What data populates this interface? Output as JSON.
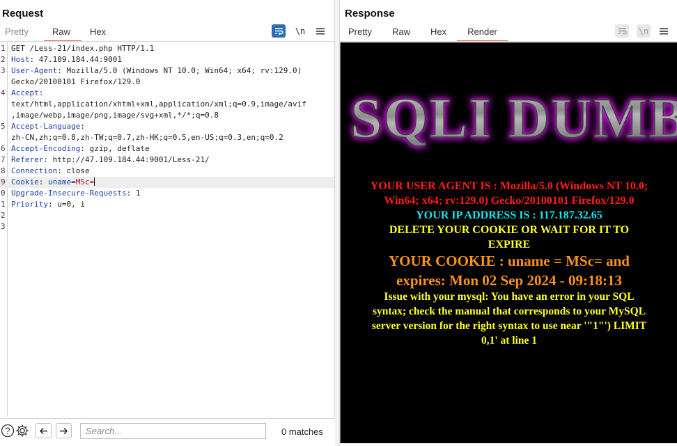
{
  "layout_switcher": {
    "options": [
      "split-columns-icon",
      "split-rows-icon",
      "tabs-icon"
    ],
    "active": 0
  },
  "request": {
    "title": "Request",
    "tabs": [
      {
        "label": "Pretty",
        "active": false,
        "muted": true
      },
      {
        "label": "Raw",
        "active": true,
        "muted": false
      },
      {
        "label": "Hex",
        "active": false,
        "muted": false
      }
    ],
    "toolbar": {
      "wrap_icon": "wrap-lines-icon",
      "newline_label": "\\n",
      "menu_icon": "menu-icon"
    },
    "lines": [
      {
        "n": "1",
        "parts": [
          {
            "t": "GET /Less-21/index.php HTTP/1.1",
            "c": ""
          }
        ]
      },
      {
        "n": "2",
        "parts": [
          {
            "t": "Host",
            "c": "hk"
          },
          {
            "t": ": 47.109.184.44:9001",
            "c": ""
          }
        ]
      },
      {
        "n": "3",
        "parts": [
          {
            "t": "User-Agent",
            "c": "hk"
          },
          {
            "t": ": Mozilla/5.0 (Windows NT 10.0; Win64; x64; rv:129.0)",
            "c": ""
          }
        ]
      },
      {
        "n": "",
        "parts": [
          {
            "t": "Gecko/20100101 Firefox/129.0",
            "c": ""
          }
        ]
      },
      {
        "n": "4",
        "parts": [
          {
            "t": "Accept",
            "c": "hk"
          },
          {
            "t": ":",
            "c": ""
          }
        ]
      },
      {
        "n": "",
        "parts": [
          {
            "t": "text/html,application/xhtml+xml,application/xml;q=0.9,image/avif",
            "c": ""
          }
        ]
      },
      {
        "n": "",
        "parts": [
          {
            "t": ",image/webp,image/png,image/svg+xml,*/*;q=0.8",
            "c": ""
          }
        ]
      },
      {
        "n": "5",
        "parts": [
          {
            "t": "Accept-Language",
            "c": "hk"
          },
          {
            "t": ":",
            "c": ""
          }
        ]
      },
      {
        "n": "",
        "parts": [
          {
            "t": "zh-CN,zh;q=0.8,zh-TW;q=0.7,zh-HK;q=0.5,en-US;q=0.3,en;q=0.2",
            "c": ""
          }
        ]
      },
      {
        "n": "6",
        "parts": [
          {
            "t": "Accept-Encoding",
            "c": "hk"
          },
          {
            "t": ": gzip, deflate",
            "c": ""
          }
        ]
      },
      {
        "n": "7",
        "parts": [
          {
            "t": "Referer",
            "c": "hk"
          },
          {
            "t": ": http://47.109.184.44:9001/Less-21/",
            "c": ""
          }
        ]
      },
      {
        "n": "8",
        "parts": [
          {
            "t": "Connection",
            "c": "hk"
          },
          {
            "t": ": close",
            "c": ""
          }
        ]
      },
      {
        "n": "9",
        "parts": [
          {
            "t": "Cookie",
            "c": "hk"
          },
          {
            "t": ": ",
            "c": ""
          },
          {
            "t": "uname",
            "c": "hk"
          },
          {
            "t": "=",
            "c": ""
          },
          {
            "t": "MSc=",
            "c": "cv"
          }
        ],
        "highlight": true,
        "caret": true
      },
      {
        "n": "0",
        "parts": [
          {
            "t": "Upgrade-Insecure-Requests",
            "c": "hk"
          },
          {
            "t": ": 1",
            "c": ""
          }
        ]
      },
      {
        "n": "1",
        "parts": [
          {
            "t": "Priority",
            "c": "hk"
          },
          {
            "t": ": u=0, i",
            "c": ""
          }
        ]
      },
      {
        "n": "2",
        "parts": []
      },
      {
        "n": "3",
        "parts": []
      }
    ],
    "search": {
      "placeholder": "Search...",
      "value": "",
      "matches": "0 matches",
      "help_icon": "help-icon",
      "settings_icon": "gear-icon",
      "prev_icon": "arrow-left-icon",
      "next_icon": "arrow-right-icon"
    }
  },
  "response": {
    "title": "Response",
    "tabs": [
      {
        "label": "Pretty",
        "active": false,
        "muted": false
      },
      {
        "label": "Raw",
        "active": false,
        "muted": false
      },
      {
        "label": "Hex",
        "active": false,
        "muted": false
      },
      {
        "label": "Render",
        "active": true,
        "muted": false
      }
    ],
    "toolbar": {
      "wrap_icon": "wrap-lines-icon",
      "newline_label": "\\n",
      "menu_icon": "menu-icon"
    },
    "render": {
      "logo_text": "SQLI DUMB SERIES",
      "user_agent_lines": [
        "YOUR USER AGENT IS : Mozilla/5.0 (Windows NT 10.0;",
        "Win64; x64; rv:129.0) Gecko/20100101 Firefox/129.0"
      ],
      "ip_line": "YOUR IP ADDRESS IS : 117.187.32.65",
      "delete_lines": [
        "DELETE YOUR COOKIE OR WAIT FOR IT TO",
        "EXPIRE"
      ],
      "cookie_lines": [
        "YOUR COOKIE : uname = MSc= and",
        "expires: Mon 02 Sep 2024 - 09:18:13"
      ],
      "error_lines": [
        "Issue with your mysql: You have an error in your SQL",
        "syntax; check the manual that corresponds to your MySQL",
        "server version for the right syntax to use near '\"1\"') LIMIT",
        "0,1' at line 1"
      ],
      "colors": {
        "red": "#ff1c1c",
        "cyan": "#19e6ef",
        "yellow": "#ffff22",
        "orange": "#f7921e",
        "logo_glow": "#c41bd6"
      }
    }
  }
}
